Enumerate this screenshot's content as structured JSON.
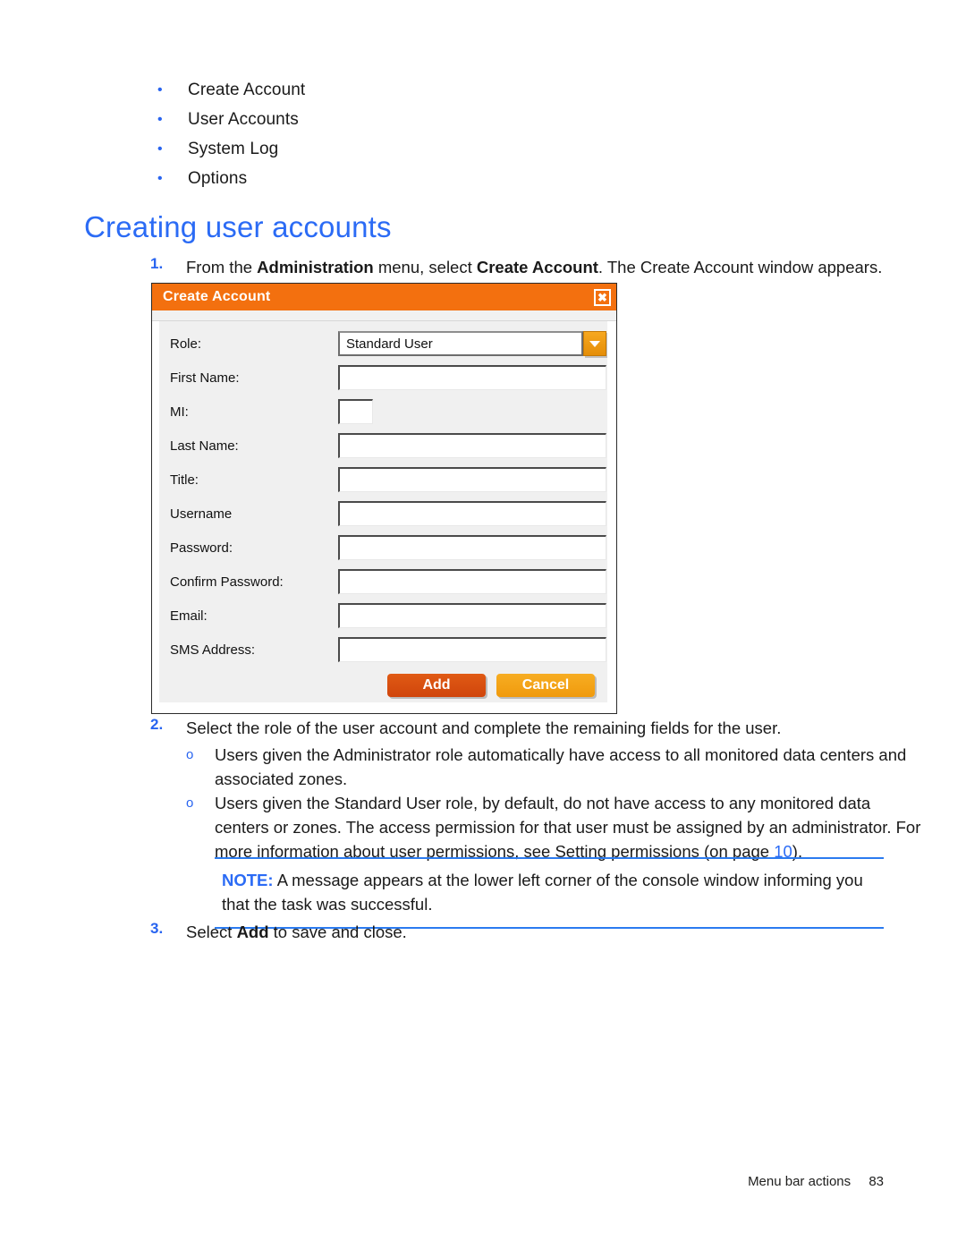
{
  "page": {
    "heading": "Creating user accounts",
    "bullets": [
      {
        "label": "Create Account"
      },
      {
        "label": "User Accounts"
      },
      {
        "label": "System Log"
      },
      {
        "label": "Options"
      }
    ],
    "steps": {
      "step1": {
        "number": "1.",
        "text_before": "From the ",
        "bold1": "Administration",
        "text_mid": " menu, select ",
        "bold2": "Create Account",
        "text_after": ". The Create Account window appears."
      },
      "step2": {
        "number": "2.",
        "text": "Select the role of the user account and complete the remaining fields for the user."
      },
      "step3": {
        "number": "3.",
        "text_before": "Select ",
        "bold1": "Add",
        "text_after": " to save and close."
      }
    },
    "subitems": [
      {
        "mark": "o",
        "text": "Users given the Administrator role automatically have access to all monitored data centers and associated zones."
      },
      {
        "mark": "o",
        "text_before": "Users given the Standard User role, by default, do not have access to any monitored data centers or zones. The access permission for that user must be assigned by an administrator. For more information about user permissions, see Setting permissions (on page ",
        "link": "10",
        "text_after": ")."
      }
    ],
    "note": {
      "label": "NOTE:",
      "text": "A message appears at the lower left corner of the console window informing you that the task was successful."
    },
    "footer": {
      "section": "Menu bar actions",
      "page_number": "83"
    }
  },
  "dialog": {
    "title": "Create Account",
    "close_icon": "close-icon",
    "dropdown_icon": "chevron-down-icon",
    "fields": [
      {
        "label": "Role:",
        "type": "select",
        "value": "Standard User",
        "placeholder": ""
      },
      {
        "label": "First Name:",
        "type": "text",
        "value": "",
        "placeholder": ""
      },
      {
        "label": "MI:",
        "type": "text",
        "value": "",
        "placeholder": "",
        "size": "mi"
      },
      {
        "label": "Last Name:",
        "type": "text",
        "value": "",
        "placeholder": ""
      },
      {
        "label": "Title:",
        "type": "text",
        "value": "",
        "placeholder": ""
      },
      {
        "label": "Username",
        "type": "text",
        "value": "",
        "placeholder": ""
      },
      {
        "label": "Password:",
        "type": "text",
        "value": "",
        "placeholder": ""
      },
      {
        "label": "Confirm Password:",
        "type": "text",
        "value": "",
        "placeholder": ""
      },
      {
        "label": "Email:",
        "type": "text",
        "value": "",
        "placeholder": ""
      },
      {
        "label": "SMS Address:",
        "type": "text",
        "value": "",
        "placeholder": ""
      }
    ],
    "buttons": {
      "add": "Add",
      "cancel": "Cancel"
    }
  },
  "colors": {
    "heading_blue": "#2b6bf5",
    "accent_orange": "#f3700f",
    "add_button": "#d84a10",
    "cancel_button": "#f5a319",
    "note_rule": "#2b7bf0"
  }
}
